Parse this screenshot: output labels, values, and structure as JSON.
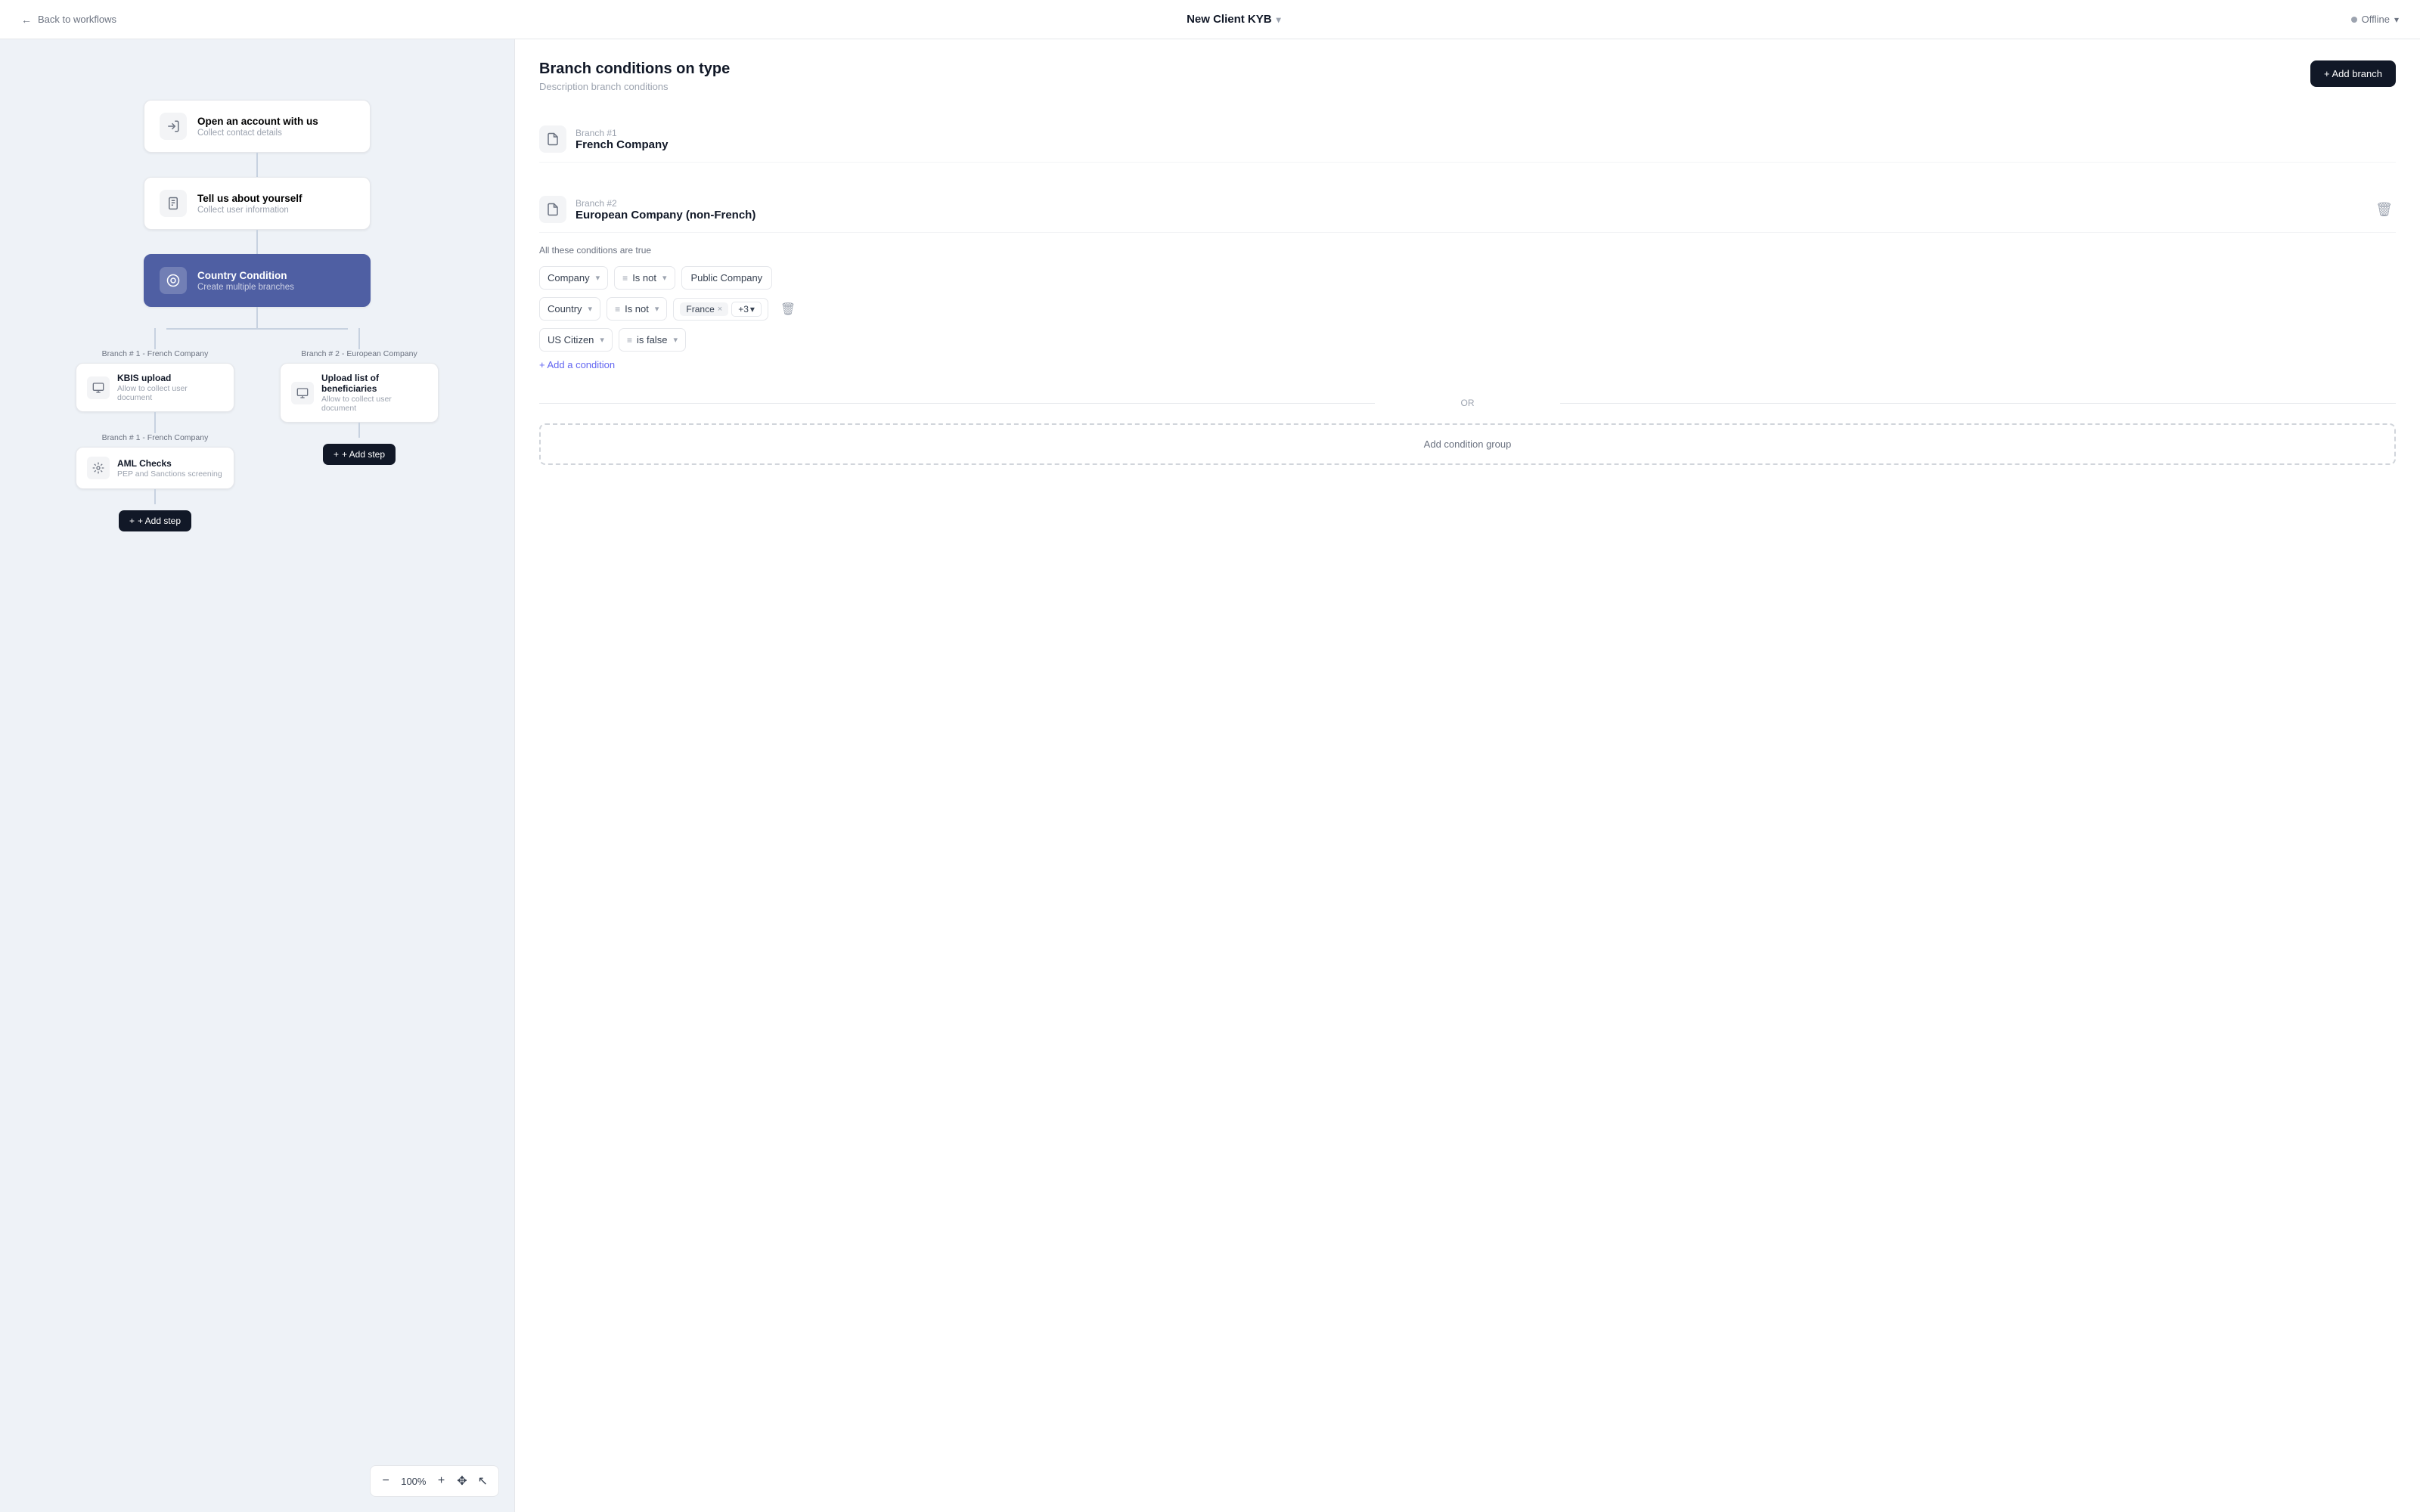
{
  "header": {
    "back_label": "Back to workflows",
    "title": "New Client KYB",
    "status": "Offline"
  },
  "canvas": {
    "zoom": "100%",
    "nodes": [
      {
        "title": "Open an account with us",
        "subtitle": "Collect contact details",
        "active": false
      },
      {
        "title": "Tell us about yourself",
        "subtitle": "Collect user information",
        "active": false
      },
      {
        "title": "Country Condition",
        "subtitle": "Create multiple branches",
        "active": true
      }
    ],
    "branches": [
      {
        "label": "Branch # 1 - French Company",
        "node_title": "KBIS upload",
        "node_subtitle": "Allow to collect user document",
        "aml_title": "AML Checks",
        "aml_subtitle": "PEP and Sanctions screening"
      },
      {
        "label": "Branch # 2 - European Company",
        "node_title": "Upload list of beneficiaries",
        "node_subtitle": "Allow to collect user document"
      }
    ],
    "add_step_label": "+ Add step"
  },
  "panel": {
    "title": "Branch conditions on type",
    "description": "Description branch conditions",
    "add_branch_label": "+ Add branch",
    "branches": [
      {
        "number": "Branch #1",
        "name": "French Company"
      },
      {
        "number": "Branch #2",
        "name": "European Company (non-French)",
        "conditions_label": "All these conditions are true",
        "conditions": [
          {
            "field": "Company",
            "operator_icon": "list",
            "operator": "Is not",
            "value_text": "Public Company",
            "has_tags": false,
            "has_delete": false
          },
          {
            "field": "Country",
            "operator_icon": "list",
            "operator": "Is not",
            "tag": "France",
            "tag_more": "+3",
            "has_tags": true,
            "has_delete": true
          },
          {
            "field": "US Citizen",
            "operator_icon": "list",
            "operator": "is false",
            "has_tags": false,
            "has_delete": false
          }
        ],
        "add_condition_label": "+ Add a condition"
      }
    ],
    "or_label": "OR",
    "add_condition_group_label": "Add condition group"
  }
}
